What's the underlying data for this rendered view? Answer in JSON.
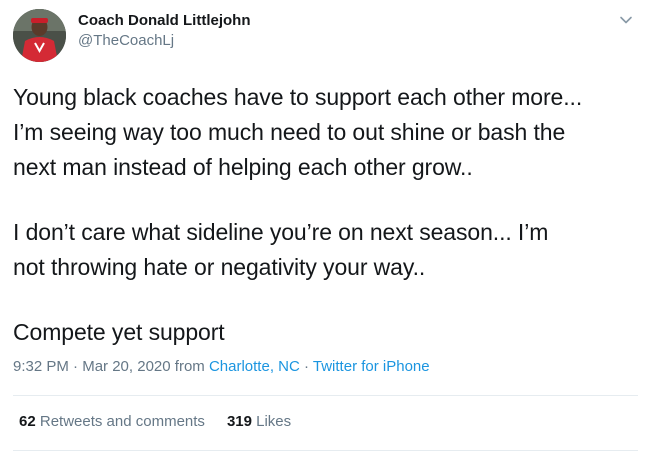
{
  "author": {
    "display_name": "Coach Donald Littlejohn",
    "handle": "@TheCoachLj",
    "avatar_icon": "profile-photo"
  },
  "tweet": {
    "paragraphs": [
      "Young black coaches have to support each other more...\nI’m seeing way too much need to out shine or bash the\nnext man instead of helping each other grow..",
      "I don’t care what sideline you’re on next season... I’m\nnot throwing hate or negativity your way..",
      "Compete yet support"
    ]
  },
  "meta": {
    "time": "9:32 PM",
    "sep1": " · ",
    "date": "Mar 20, 2020",
    "from": " from ",
    "location": "Charlotte, NC",
    "sep2": " · ",
    "client": "Twitter for iPhone"
  },
  "stats": {
    "retweets_count": "62",
    "retweets_label": " Retweets and comments",
    "likes_count": "319",
    "likes_label": " Likes"
  },
  "colors": {
    "text": "#14171a",
    "secondary": "#657786",
    "link": "#1b95e0",
    "divider": "#e6ecf0"
  }
}
